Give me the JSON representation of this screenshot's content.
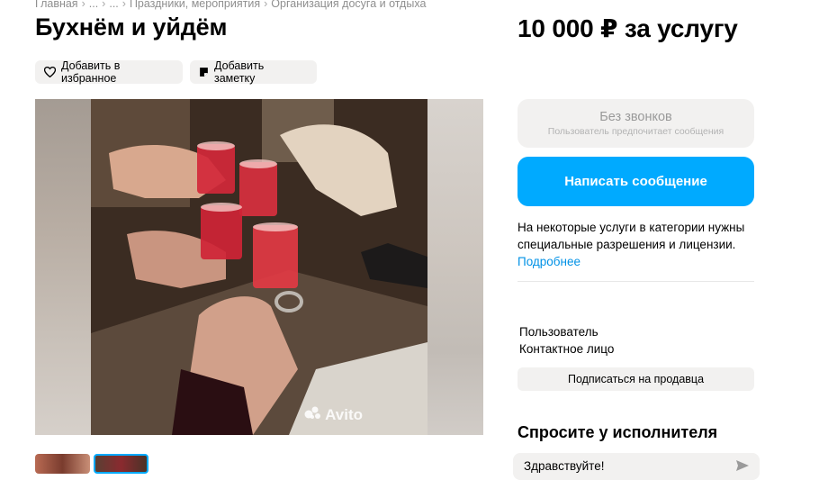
{
  "breadcrumb": [
    "Главная",
    "...",
    "...",
    "Праздники, мероприятия",
    "Организация досуга и отдыха"
  ],
  "title": "Бухнём и уйдём",
  "price": "10 000 ₽ за услугу",
  "actions": {
    "favorite_label": "Добавить в избранное",
    "note_label": "Добавить заметку"
  },
  "gallery": {
    "watermark": "Avito",
    "thumb_count": 2,
    "selected_thumb": 2
  },
  "contact": {
    "calls_title": "Без звонков",
    "calls_sub": "Пользователь предпочитает сообщения",
    "message_button": "Написать сообщение"
  },
  "notice": {
    "text": "На некоторые услуги в категории нужны специальные разрешения и лицензии.",
    "link": "Подробнее"
  },
  "seller": {
    "name": "Пользователь",
    "role": "Контактное лицо",
    "subscribe_button": "Подписаться на продавца"
  },
  "ask": {
    "title": "Спросите у исполнителя",
    "input_value": "Здравствуйте!"
  },
  "colors": {
    "accent": "#00aaff",
    "link": "#0091e6",
    "chip_bg": "#f2f1f0"
  }
}
